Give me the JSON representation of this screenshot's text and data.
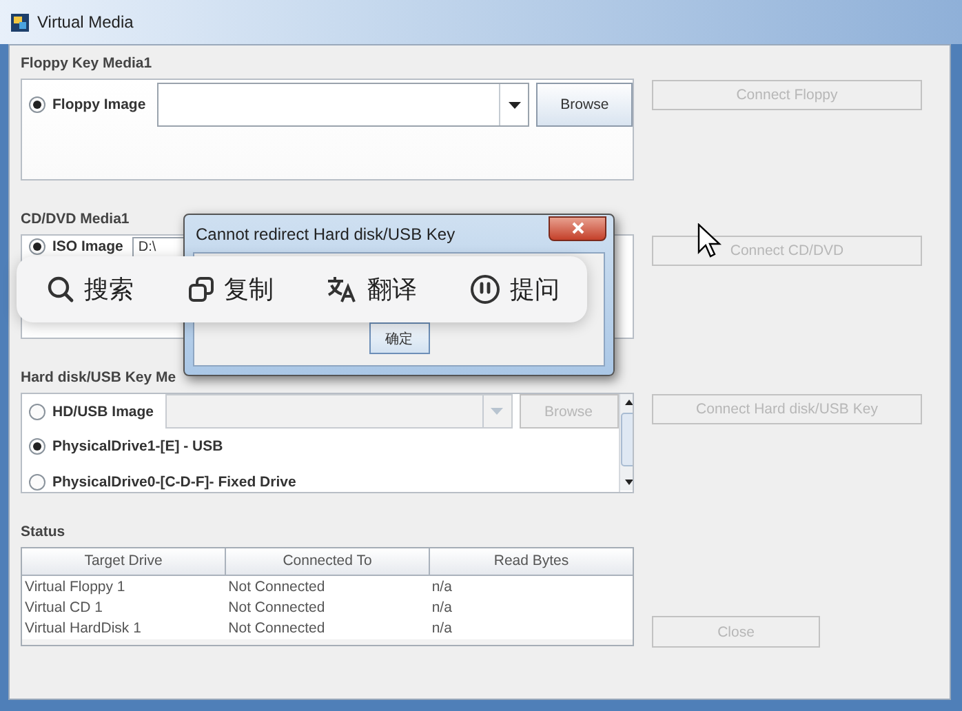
{
  "window": {
    "title": "Virtual Media"
  },
  "floppy": {
    "title": "Floppy Key Media1",
    "options": [
      {
        "label": "Floppy Image",
        "selected": true
      }
    ],
    "browse": {
      "label": "Browse",
      "disabled": false
    },
    "connect": {
      "label": "Connect Floppy",
      "disabled": true
    }
  },
  "cd_dvd": {
    "title": "CD/DVD Media1",
    "options": [
      {
        "label": "ISO Image",
        "selected": true
      }
    ],
    "path": "D:\\",
    "connect": {
      "label": "Connect CD/DVD",
      "disabled": true
    }
  },
  "hard_disk": {
    "title": "Hard disk/USB Key Me",
    "options": [
      {
        "kind": "image",
        "label": "HD/USB Image",
        "selected": false
      },
      {
        "kind": "drive",
        "label": "PhysicalDrive1-[E] - USB",
        "selected": true
      },
      {
        "kind": "drive",
        "label": "PhysicalDrive0-[C-D-F]- Fixed Drive",
        "selected": false
      }
    ],
    "browse": {
      "label": "Browse",
      "disabled": true
    },
    "connect": {
      "label": "Connect Hard disk/USB Key",
      "disabled": true
    }
  },
  "status": {
    "title": "Status",
    "columns": [
      "Target Drive",
      "Connected To",
      "Read Bytes"
    ],
    "rows": [
      [
        "Virtual Floppy 1",
        "Not Connected",
        "n/a"
      ],
      [
        "Virtual CD 1",
        "Not Connected",
        "n/a"
      ],
      [
        "Virtual HardDisk 1",
        "Not Connected",
        "n/a"
      ]
    ]
  },
  "close": {
    "label": "Close",
    "disabled": true
  },
  "dialog": {
    "title": "Cannot redirect Hard disk/USB Key",
    "button": "确定"
  },
  "popup": {
    "items": [
      {
        "kind": "search",
        "label": "搜索"
      },
      {
        "kind": "copy",
        "label": "复制"
      },
      {
        "kind": "translate",
        "label": "翻译"
      },
      {
        "kind": "ask",
        "label": "提问"
      }
    ]
  }
}
